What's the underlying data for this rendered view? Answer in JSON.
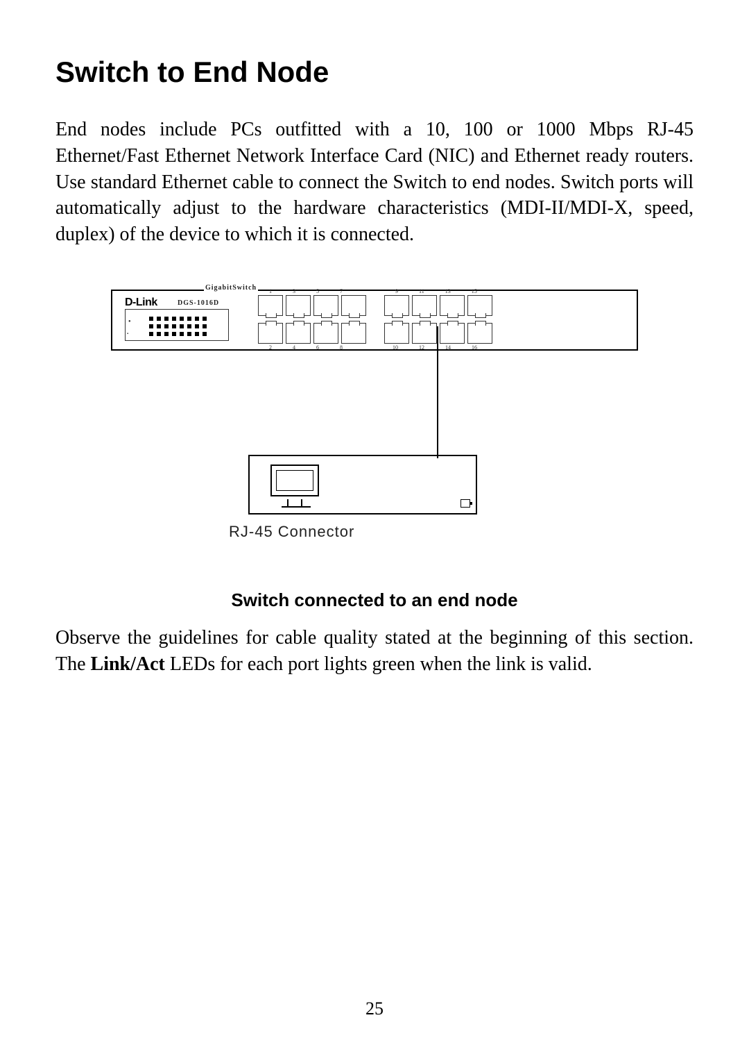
{
  "heading": "Switch to End Node",
  "paragraph1": "End nodes include PCs outfitted with a 10, 100 or 1000 Mbps RJ-45 Ethernet/Fast Ethernet Network Interface Card (NIC) and Ethernet ready routers. Use standard Ethernet cable to connect the Switch to end nodes. Switch ports will automatically adjust to the hardware characteristics (MDI-II/MDI-X, speed, duplex) of the device to which it is connected.",
  "switch": {
    "topLabel": "GigabitSwitch",
    "brand": "D-Link",
    "model": "DGS-1016D",
    "portNumbersTopLeft": [
      "1",
      "3",
      "5",
      "7"
    ],
    "portNumbersTopRight": [
      "9",
      "11",
      "13",
      "15"
    ],
    "portNumbersBotLeft": [
      "2",
      "4",
      "6",
      "8"
    ],
    "portNumbersBotRight": [
      "10",
      "12",
      "14",
      "16"
    ]
  },
  "figureSublabel": "RJ-45 Connector",
  "figureCaption": "Switch connected to an end node",
  "paragraph2_a": "Observe the guidelines for cable quality stated at the beginning of this section. The ",
  "paragraph2_bold": "Link/Act",
  "paragraph2_b": " LEDs for each port lights green when the link is valid.",
  "pageNumber": "25"
}
